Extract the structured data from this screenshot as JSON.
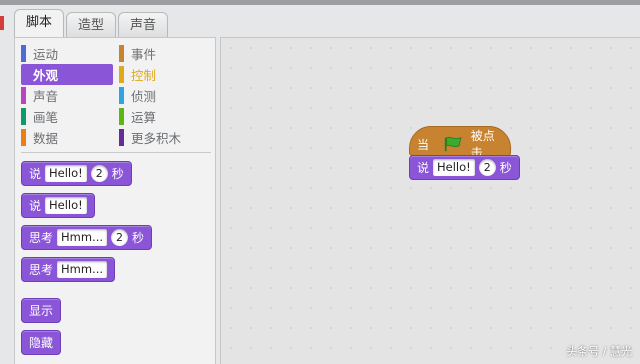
{
  "tabs": [
    {
      "label": "脚本",
      "active": true
    },
    {
      "label": "造型",
      "active": false
    },
    {
      "label": "声音",
      "active": false
    }
  ],
  "categories": [
    {
      "label": "运动",
      "color": "#4a6cd4"
    },
    {
      "label": "事件",
      "color": "#c88330"
    },
    {
      "label": "外观",
      "color": "#8a55d7",
      "selected": true
    },
    {
      "label": "控制",
      "color": "#e1a91a"
    },
    {
      "label": "声音",
      "color": "#bb42c3"
    },
    {
      "label": "侦测",
      "color": "#2ca5e2"
    },
    {
      "label": "画笔",
      "color": "#0e9a6c"
    },
    {
      "label": "运算",
      "color": "#5cb712"
    },
    {
      "label": "数据",
      "color": "#ee7d16"
    },
    {
      "label": "更多积木",
      "color": "#632d99"
    }
  ],
  "palette_blocks": {
    "say_for": {
      "label": "说",
      "text": "Hello!",
      "secs": "2",
      "unit": "秒"
    },
    "say": {
      "label": "说",
      "text": "Hello!"
    },
    "think_for": {
      "label": "思考",
      "text": "Hmm...",
      "secs": "2",
      "unit": "秒"
    },
    "think": {
      "label": "思考",
      "text": "Hmm..."
    },
    "show": {
      "label": "显示"
    },
    "hide": {
      "label": "隐藏"
    }
  },
  "script": {
    "hat": {
      "before": "当",
      "icon": "green-flag-icon",
      "after": "被点击"
    },
    "say_for": {
      "label": "说",
      "text": "Hello!",
      "secs": "2",
      "unit": "秒"
    }
  },
  "watermark": "头条号 / 慧光",
  "colors": {
    "looks": "#8a55d7",
    "events": "#c88330",
    "flag": "#3aab2e"
  }
}
